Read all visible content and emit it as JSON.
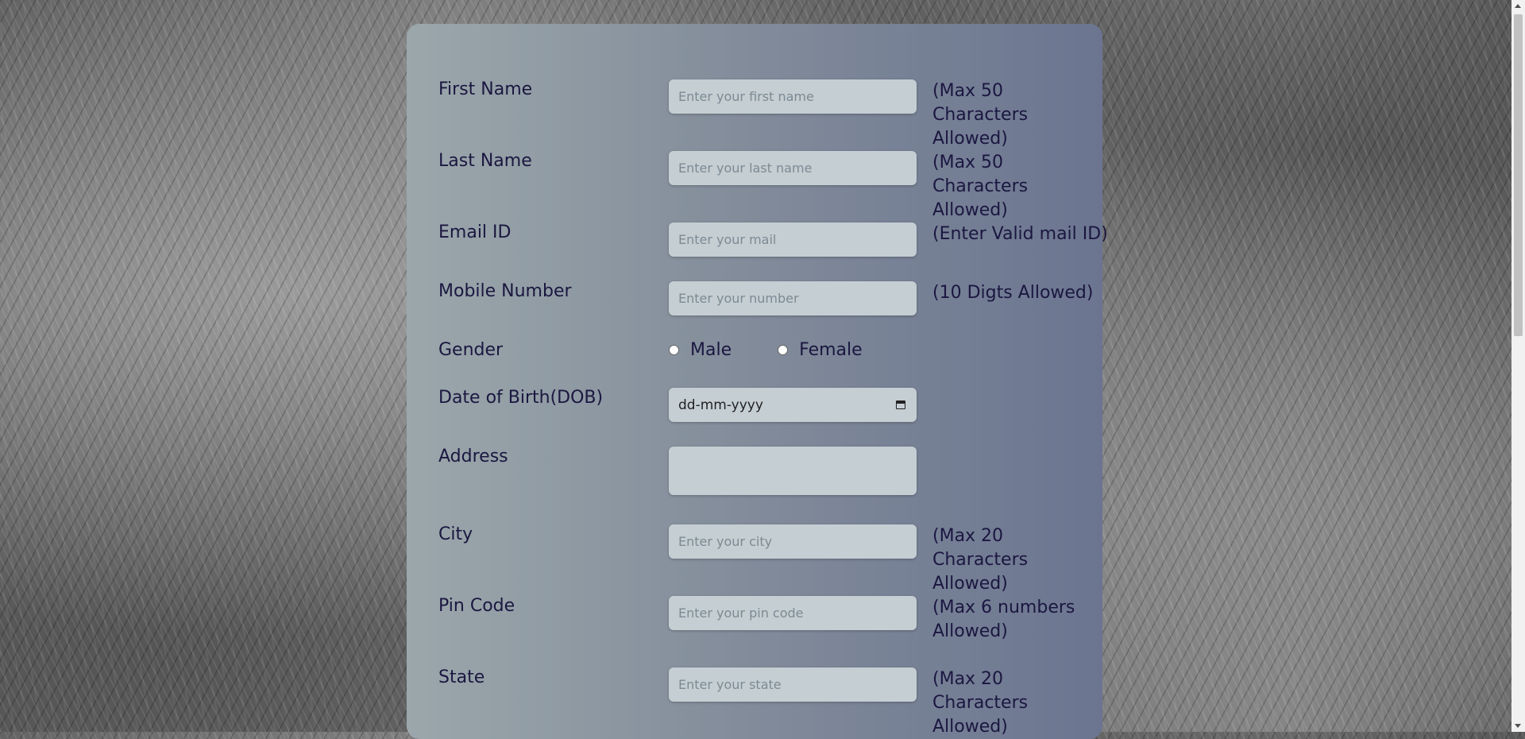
{
  "form": {
    "first_name": {
      "label": "First Name",
      "placeholder": "Enter your first name",
      "note": "(Max 50 Characters Allowed)"
    },
    "last_name": {
      "label": "Last Name",
      "placeholder": "Enter your last name",
      "note": "(Max 50 Characters Allowed)"
    },
    "email": {
      "label": "Email ID",
      "placeholder": "Enter your mail",
      "note": "(Enter Valid mail ID)"
    },
    "mobile": {
      "label": "Mobile Number",
      "placeholder": "Enter your number",
      "note": "(10 Digts Allowed)"
    },
    "gender": {
      "label": "Gender",
      "options": [
        "Male",
        "Female"
      ]
    },
    "dob": {
      "label": "Date of Birth(DOB)",
      "value": "dd-mm-yyyy",
      "icon": "calendar-icon"
    },
    "address": {
      "label": "Address",
      "placeholder": ""
    },
    "city": {
      "label": "City",
      "placeholder": "Enter your city",
      "note": "(Max 20 Characters Allowed)"
    },
    "pin": {
      "label": "Pin Code",
      "placeholder": "Enter your pin code",
      "note": "(Max 6 numbers Allowed)"
    },
    "state": {
      "label": "State",
      "placeholder": "Enter your state",
      "note": "(Max 20 Characters Allowed)"
    }
  },
  "colors": {
    "label_text": "#1b1740",
    "input_bg": "#c4ced3",
    "card_gradient_start": "#9ba7ab",
    "card_gradient_end": "#6b7590"
  }
}
